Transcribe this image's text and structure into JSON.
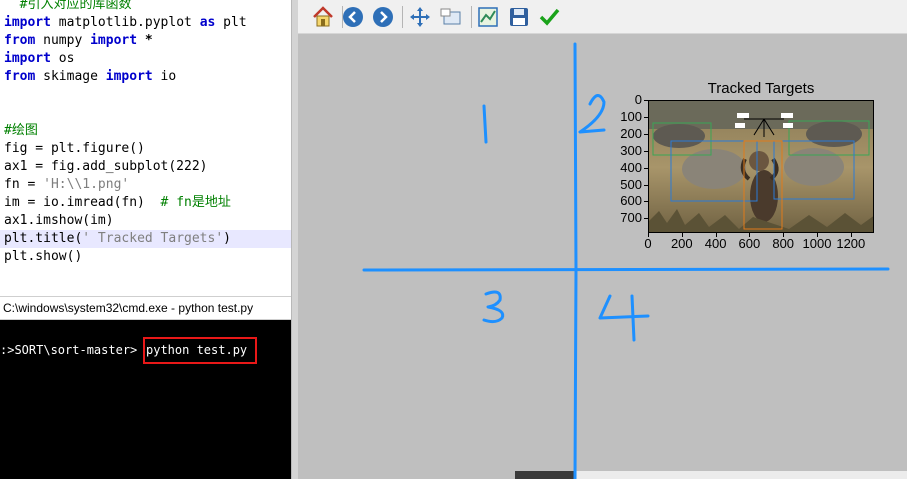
{
  "editor": {
    "lines": [
      {
        "parts": [
          {
            "t": "  #引入对应的库函数",
            "c": "cm"
          }
        ]
      },
      {
        "parts": [
          {
            "t": "import",
            "c": "kw"
          },
          {
            "t": " matplotlib.pyplot ",
            "c": ""
          },
          {
            "t": "as",
            "c": "kw"
          },
          {
            "t": " plt",
            "c": ""
          }
        ]
      },
      {
        "parts": [
          {
            "t": "from",
            "c": "kw"
          },
          {
            "t": " numpy ",
            "c": ""
          },
          {
            "t": "import",
            "c": "kw"
          },
          {
            "t": " *",
            "c": "op"
          }
        ]
      },
      {
        "parts": [
          {
            "t": "import",
            "c": "kw"
          },
          {
            "t": " os",
            "c": ""
          }
        ]
      },
      {
        "parts": [
          {
            "t": "from",
            "c": "kw"
          },
          {
            "t": " skimage ",
            "c": ""
          },
          {
            "t": "import",
            "c": "kw"
          },
          {
            "t": " io",
            "c": ""
          }
        ]
      },
      {
        "parts": []
      },
      {
        "parts": []
      },
      {
        "parts": [
          {
            "t": "#绘图",
            "c": "cm"
          }
        ]
      },
      {
        "parts": [
          {
            "t": "fig = plt.figure()",
            "c": ""
          }
        ]
      },
      {
        "parts": [
          {
            "t": "ax1 = fig.add_subplot(222)",
            "c": ""
          }
        ]
      },
      {
        "parts": [
          {
            "t": "fn = ",
            "c": ""
          },
          {
            "t": "'H:\\\\1.png'",
            "c": "str"
          }
        ]
      },
      {
        "parts": [
          {
            "t": "im = io.imread(fn)  ",
            "c": ""
          },
          {
            "t": "# fn是地址",
            "c": "cm"
          }
        ]
      },
      {
        "parts": [
          {
            "t": "ax1.imshow(im)",
            "c": ""
          }
        ]
      },
      {
        "parts": [
          {
            "t": "plt.title(",
            "c": ""
          },
          {
            "t": "' Tracked Targets'",
            "c": "str"
          },
          {
            "t": ")",
            "c": ""
          }
        ]
      },
      {
        "parts": [
          {
            "t": "plt.show()",
            "c": ""
          }
        ]
      }
    ],
    "highlight_line": 13
  },
  "console": {
    "title": "C:\\windows\\system32\\cmd.exe - python  test.py",
    "prompt": ":>SORT\\sort-master>",
    "command": "python test.py"
  },
  "toolbar": {
    "buttons": [
      {
        "name": "home-button",
        "icon": "home-icon"
      },
      {
        "name": "back-button",
        "icon": "arrow-left-icon"
      },
      {
        "name": "forward-button",
        "icon": "arrow-right-icon"
      },
      {
        "name": "pan-button",
        "icon": "move-icon"
      },
      {
        "name": "zoom-button",
        "icon": "zoom-rect-icon"
      },
      {
        "name": "subplots-button",
        "icon": "configure-subplots-icon"
      },
      {
        "name": "save-button",
        "icon": "floppy-disk-icon"
      },
      {
        "name": "edit-button",
        "icon": "checkmark-icon"
      }
    ]
  },
  "plot": {
    "title": "Tracked Targets",
    "yticks": [
      "0",
      "100",
      "200",
      "300",
      "400",
      "500",
      "600",
      "700"
    ],
    "xticks": [
      "0",
      "200",
      "400",
      "600",
      "800",
      "1000",
      "1200"
    ]
  },
  "annotations": {
    "color": "#1e90ff",
    "quadrants": [
      "1",
      "2",
      "3",
      "4"
    ]
  }
}
